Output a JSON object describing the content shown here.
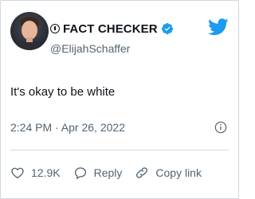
{
  "author": {
    "display_name": "FACT CHECKER",
    "handle": "@ElijahSchaffer",
    "verified": true,
    "name_prefix_icon": "circled-info-icon"
  },
  "tweet": {
    "text": "It's okay to be white",
    "timestamp": "2:24 PM · Apr 26, 2022"
  },
  "actions": {
    "like_count": "12.9K",
    "reply_label": "Reply",
    "copy_link_label": "Copy link"
  },
  "icons": {
    "brand": "twitter-bird-icon",
    "info": "info-icon",
    "like": "heart-icon",
    "reply": "reply-bubble-icon",
    "copy_link": "link-icon"
  },
  "colors": {
    "twitter_blue": "#1d9bf0",
    "text": "#0f1419",
    "muted": "#536471",
    "border": "#cfd9de"
  }
}
